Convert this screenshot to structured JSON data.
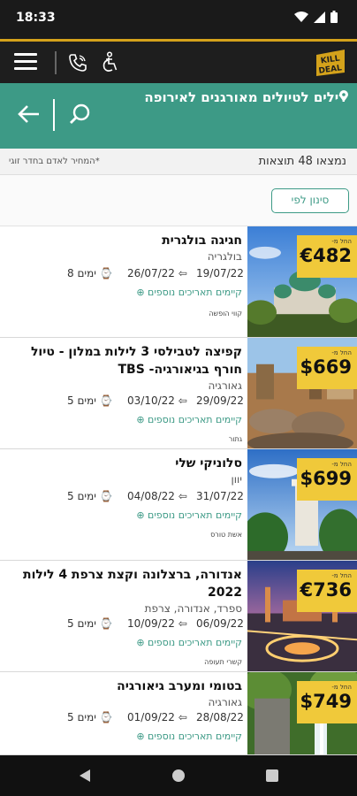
{
  "status": {
    "time": "18:33"
  },
  "header": {
    "search_title": "דילים לטיולים מאורגנים לאירופה"
  },
  "results": {
    "count_text": "נמצאו 48 תוצאות",
    "price_note": "*המחיר לאדם בחדר זוגי"
  },
  "filter": {
    "label": "סינון לפי"
  },
  "colors": {
    "accent": "#3d9a86",
    "badge": "#f0c93a",
    "topbar": "#1e1e1e",
    "gold": "#d4a21b"
  },
  "deals": [
    {
      "title": "חגיגה בולגרית",
      "country": "בולגריה",
      "from_label": "החל מ-",
      "price": "€482",
      "dep": "19/07/22",
      "ret": "26/07/22",
      "nights": "8 ימים",
      "more": "קיימים תאריכים נוספים",
      "airline": "קווי הופשה",
      "image": "alexander-nevsky-cathedral"
    },
    {
      "title": "קפיצה לטבילסי 3 לילות במלון - טיול חורף בגיאורגיה- TBS",
      "country": "גאורגיה",
      "from_label": "החל מ-",
      "price": "$669",
      "dep": "29/09/22",
      "ret": "03/10/22",
      "nights": "5 ימים",
      "more": "קיימים תאריכים נוספים",
      "airline": "גתור",
      "image": "tbilisi-old-town"
    },
    {
      "title": "סלוניקי שלי",
      "country": "יוון",
      "from_label": "החל מ-",
      "price": "$699",
      "dep": "31/07/22",
      "ret": "04/08/22",
      "nights": "5 ימים",
      "more": "קיימים תאריכים נוספים",
      "airline": "אשת טורס",
      "image": "white-tower-thessaloniki"
    },
    {
      "title": "אנדורה, ברצלונה וקצת צרפת 4 לילות 2022",
      "country": "ספרד, אנדורה, צרפת",
      "from_label": "החל מ-",
      "price": "€736",
      "dep": "06/09/22",
      "ret": "10/09/22",
      "nights": "5 ימים",
      "more": "קיימים תאריכים נוספים",
      "airline": "קשרי תעופה",
      "image": "barcelona-placa-espanya"
    },
    {
      "title": "בטומי ומערב גיאורגיה",
      "country": "גאורגיה",
      "from_label": "החל מ-",
      "price": "$749",
      "dep": "28/08/22",
      "ret": "01/09/22",
      "nights": "5 ימים",
      "more": "קיימים תאריכים נוספים",
      "airline": "",
      "image": "georgia-waterfall"
    }
  ]
}
